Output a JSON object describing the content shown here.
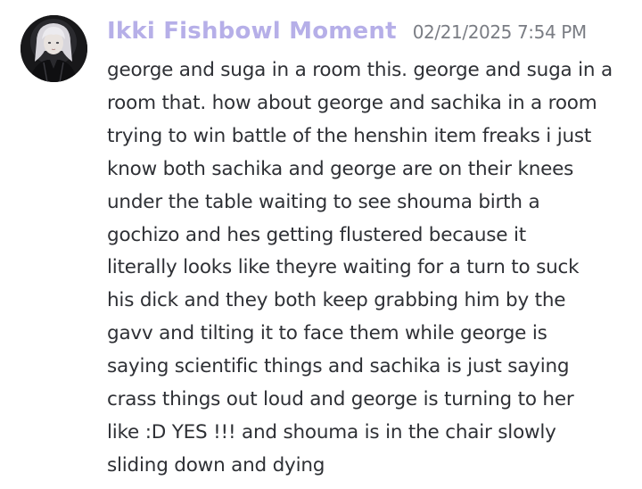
{
  "message": {
    "author": "Ikki Fishbowl Moment",
    "timestamp": "02/21/2025 7:54 PM",
    "lines": [
      "george and suga in a room this. george and suga in a",
      "room that. how about george and sachika in a room",
      "trying to win battle of the henshin item freaks i just",
      "know both sachika and george are on their knees",
      "under the table waiting to see shouma birth a",
      "gochizo and hes getting flustered because it",
      "literally looks like theyre waiting for a turn to suck",
      "his dick and they both keep grabbing him by the",
      "gavv and tilting it to face them while george is",
      "saying scientific things and sachika is just saying",
      "crass things out loud and george is turning to her",
      "like :D YES !!! and shouma is in the chair slowly",
      "sliding down and dying"
    ]
  },
  "colors": {
    "username": "#b6afe8",
    "timestamp": "#7a7d84",
    "text": "#2e3035",
    "background": "#ffffff"
  }
}
